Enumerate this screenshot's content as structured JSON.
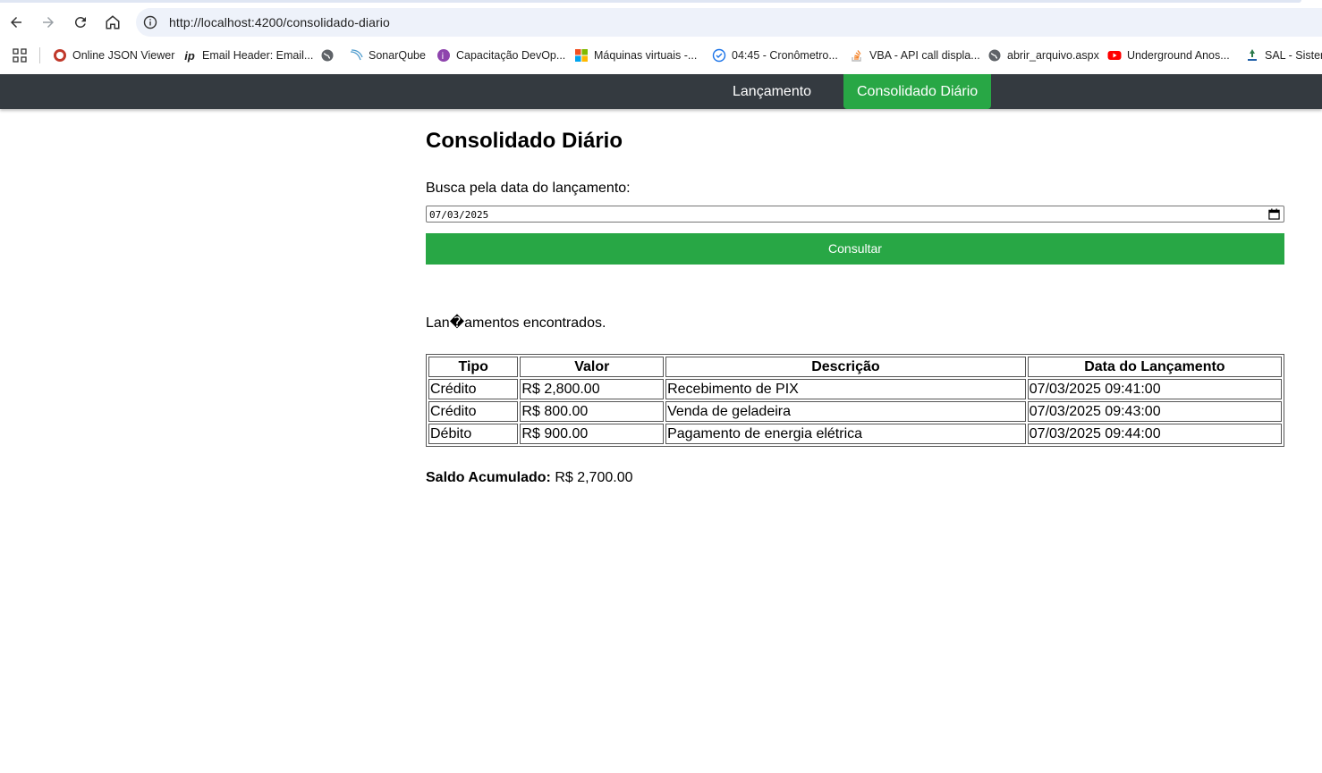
{
  "browser": {
    "url": "http://localhost:4200/consolidado-diario",
    "bookmarks": [
      {
        "label": "Online JSON Viewer",
        "icon": "json-viewer-icon"
      },
      {
        "label": "Email Header: Email...",
        "icon": "ip-icon"
      },
      {
        "label": "",
        "icon": "globe-icon"
      },
      {
        "label": "SonarQube",
        "icon": "sonarqube-icon"
      },
      {
        "label": "Capacitação DevOp...",
        "icon": "devops-icon"
      },
      {
        "label": "Máquinas virtuais -...",
        "icon": "microsoft-icon"
      },
      {
        "label": "04:45 - Cronômetro...",
        "icon": "stopwatch-icon"
      },
      {
        "label": "VBA - API call displa...",
        "icon": "stackoverflow-icon"
      },
      {
        "label": "abrir_arquivo.aspx",
        "icon": "globe-icon"
      },
      {
        "label": "Underground Anos...",
        "icon": "youtube-icon"
      },
      {
        "label": "SAL - Sistem",
        "icon": "sal-icon"
      }
    ]
  },
  "navbar": {
    "items": [
      {
        "label": "Lançamento",
        "active": false
      },
      {
        "label": "Consolidado Diário",
        "active": true
      }
    ],
    "active_color": "#28a745",
    "bg_color": "#343a40"
  },
  "page": {
    "title": "Consolidado Diário",
    "search_label": "Busca pela data do lançamento:",
    "date_value": "07/03/2025",
    "button_label": "Consultar",
    "found_message": "Lan�amentos encontrados.",
    "table": {
      "headers": [
        "Tipo",
        "Valor",
        "Descrição",
        "Data do Lançamento"
      ],
      "rows": [
        [
          "Crédito",
          "R$ 2,800.00",
          "Recebimento de PIX",
          "07/03/2025 09:41:00"
        ],
        [
          "Crédito",
          "R$ 800.00",
          "Venda de geladeira",
          "07/03/2025 09:43:00"
        ],
        [
          "Débito",
          "R$ 900.00",
          "Pagamento de energia elétrica",
          "07/03/2025 09:44:00"
        ]
      ]
    },
    "saldo_label": "Saldo Acumulado:",
    "saldo_value": "R$ 2,700.00"
  }
}
